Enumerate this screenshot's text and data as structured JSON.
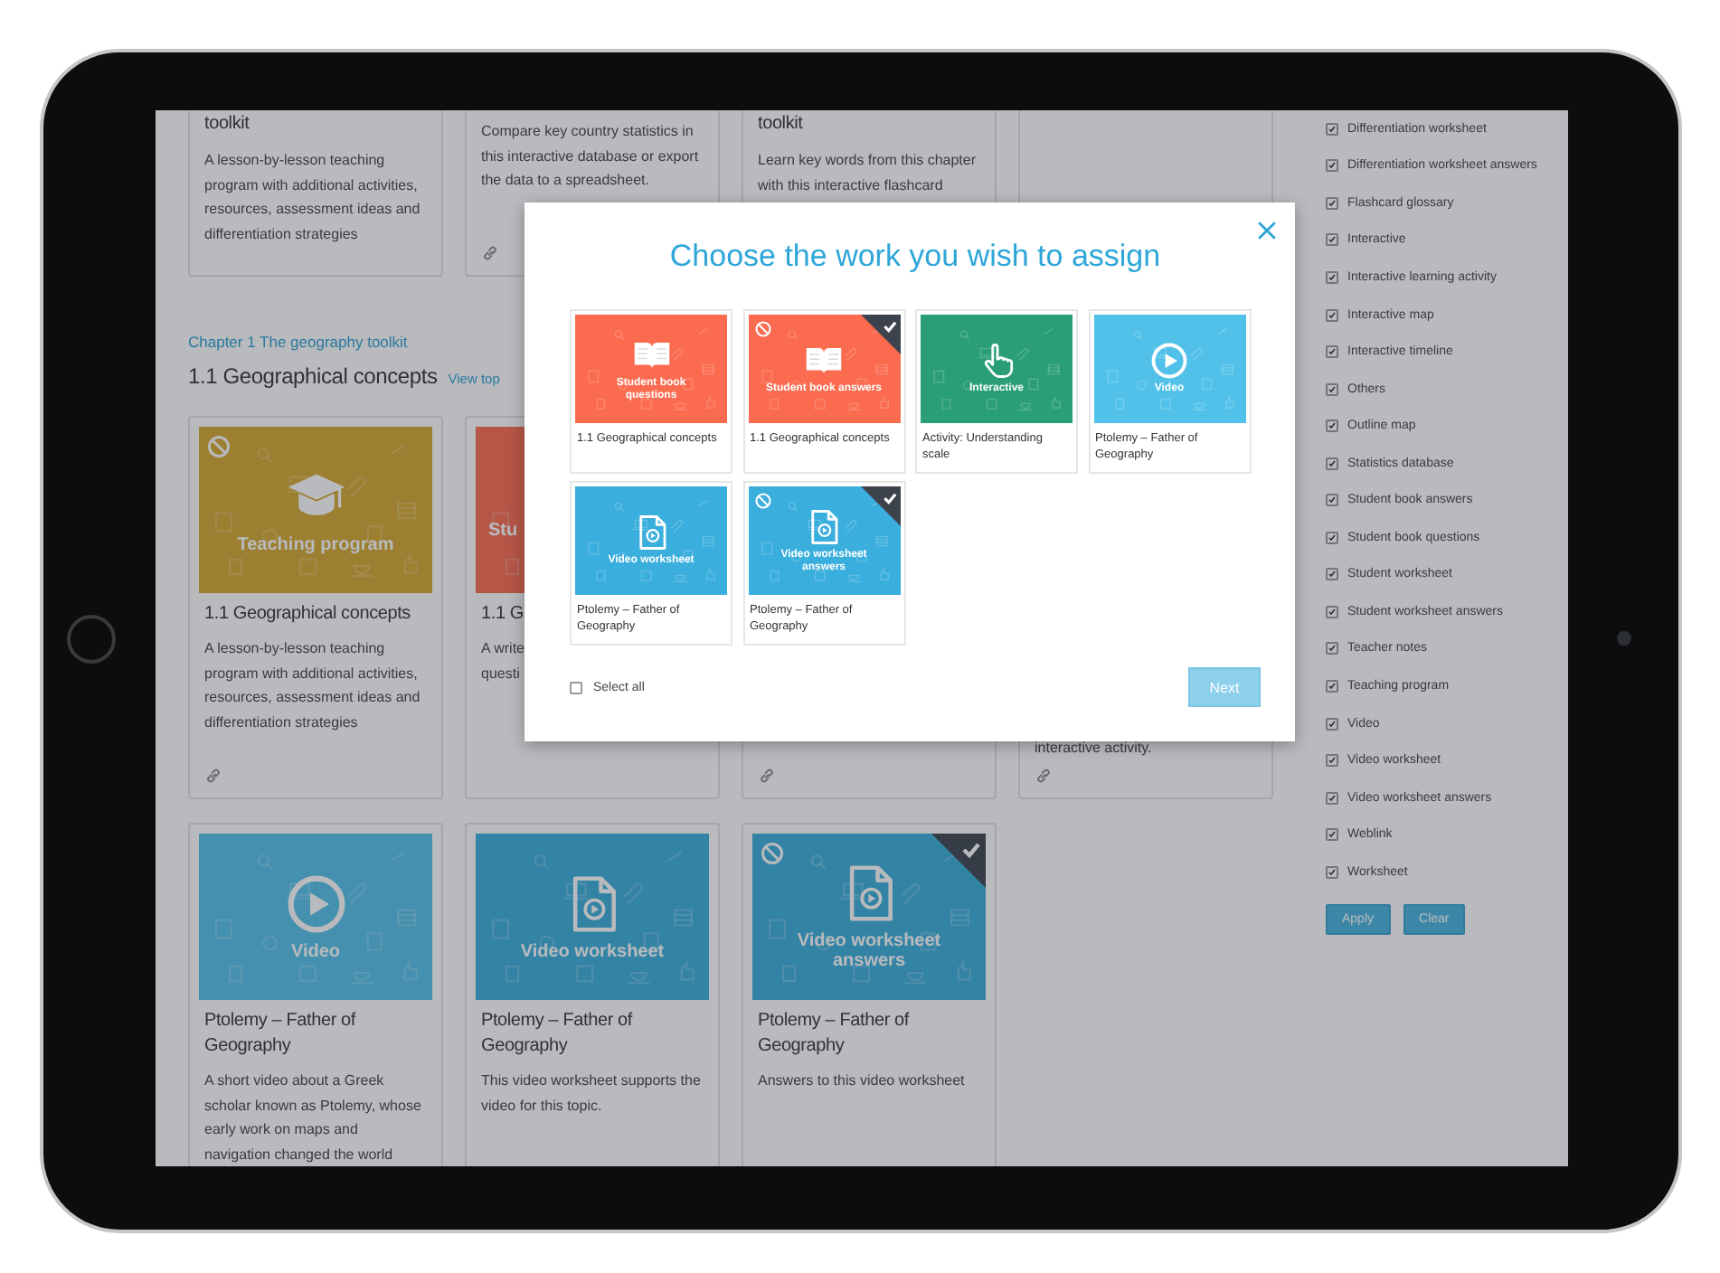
{
  "background": {
    "chapter_link": "Chapter 1 The geography toolkit",
    "heading": "1.1 Geographical concepts",
    "view_link": "View top",
    "rows": [
      {
        "cards": [
          {
            "kind": "content",
            "title": "toolkit",
            "description": "A lesson-by-lesson teaching program with additional activities, resources, assessment ideas and differentiation strategies",
            "link": false
          },
          {
            "kind": "content",
            "description": "Compare key country statistics in this interactive database or export the data to a spreadsheet.",
            "link": true
          },
          {
            "kind": "content",
            "title": "toolkit",
            "description": "Learn key words from this chapter with this interactive flashcard",
            "link": false
          },
          {
            "kind": "blank"
          }
        ]
      },
      {
        "cards": [
          {
            "kind": "content",
            "thumbnail": {
              "kind": "teaching",
              "label": "Teaching program",
              "restricted": true,
              "selected": false,
              "cut": false
            },
            "title": "1.1 Geographical concepts",
            "description": "A lesson-by-lesson teaching program with additional activities, resources, assessment ideas and differentiation strategies",
            "link": true
          },
          {
            "kind": "content",
            "thumbnail": {
              "kind": "book",
              "label": "Stu",
              "restricted": false,
              "selected": false,
              "cut": true
            },
            "title": "1.1 G",
            "description": "A write\nquesti",
            "link": false
          },
          {
            "kind": "content",
            "link": true
          },
          {
            "kind": "tail",
            "description": "interactive activity.",
            "link": true
          }
        ]
      },
      {
        "cards": [
          {
            "kind": "content",
            "thumbnail": {
              "kind": "video",
              "label": "Video",
              "restricted": false,
              "selected": false,
              "cut": false
            },
            "title": "Ptolemy – Father of Geography",
            "description": "A short video about a Greek scholar known as Ptolemy, whose early work on maps and navigation changed the world",
            "link": false
          },
          {
            "kind": "content",
            "thumbnail": {
              "kind": "video-worksheet",
              "label": "Video worksheet",
              "restricted": false,
              "selected": false,
              "cut": false
            },
            "title": "Ptolemy – Father of Geography",
            "description": "This video worksheet supports the video for this topic.",
            "link": false
          },
          {
            "kind": "content",
            "thumbnail": {
              "kind": "video-worksheet",
              "label": "Video worksheet answers",
              "restricted": true,
              "selected": true,
              "cut": false
            },
            "title": "Ptolemy – Father of Geography",
            "description": "Answers to this video worksheet",
            "link": false
          }
        ]
      }
    ]
  },
  "filters": {
    "items": [
      {
        "label": "Differentiation worksheet",
        "checked": true
      },
      {
        "label": "Differentiation worksheet answers",
        "checked": true
      },
      {
        "label": "Flashcard glossary",
        "checked": true
      },
      {
        "label": "Interactive",
        "checked": true
      },
      {
        "label": "Interactive learning activity",
        "checked": true
      },
      {
        "label": "Interactive map",
        "checked": true
      },
      {
        "label": "Interactive timeline",
        "checked": true
      },
      {
        "label": "Others",
        "checked": true
      },
      {
        "label": "Outline map",
        "checked": true
      },
      {
        "label": "Statistics database",
        "checked": true
      },
      {
        "label": "Student book answers",
        "checked": true
      },
      {
        "label": "Student book questions",
        "checked": true
      },
      {
        "label": "Student worksheet",
        "checked": true
      },
      {
        "label": "Student worksheet answers",
        "checked": true
      },
      {
        "label": "Teacher notes",
        "checked": true
      },
      {
        "label": "Teaching program",
        "checked": true
      },
      {
        "label": "Video",
        "checked": true
      },
      {
        "label": "Video worksheet",
        "checked": true
      },
      {
        "label": "Video worksheet answers",
        "checked": true
      },
      {
        "label": "Weblink",
        "checked": true
      },
      {
        "label": "Worksheet",
        "checked": true
      }
    ],
    "buttons": [
      "Apply",
      "Clear"
    ]
  },
  "modal": {
    "title": "Choose the work you wish to assign",
    "tiles": [
      {
        "thumbnail": {
          "kind": "book",
          "label": "Student book questions",
          "restricted": false,
          "selected": false,
          "cut": false
        },
        "caption": "1.1 Geographical concepts"
      },
      {
        "thumbnail": {
          "kind": "book",
          "label": "Student book answers",
          "restricted": true,
          "selected": true,
          "cut": false
        },
        "caption": "1.1 Geographical concepts"
      },
      {
        "thumbnail": {
          "kind": "interactive",
          "label": "Interactive",
          "restricted": false,
          "selected": false,
          "cut": false
        },
        "caption": "Activity: Understanding scale"
      },
      {
        "thumbnail": {
          "kind": "video",
          "label": "Video",
          "restricted": false,
          "selected": false,
          "cut": false
        },
        "caption": "Ptolemy – Father of Geography"
      },
      {
        "thumbnail": {
          "kind": "video-worksheet",
          "label": "Video worksheet",
          "restricted": false,
          "selected": false,
          "cut": false
        },
        "caption": "Ptolemy – Father of Geography"
      },
      {
        "thumbnail": {
          "kind": "video-worksheet",
          "label": "Video worksheet answers",
          "restricted": true,
          "selected": true,
          "cut": false
        },
        "caption": "Ptolemy – Father of Geography"
      }
    ],
    "select_all": {
      "label": "Select all",
      "checked": false
    },
    "next": {
      "label": "Next",
      "disabled": true
    }
  }
}
